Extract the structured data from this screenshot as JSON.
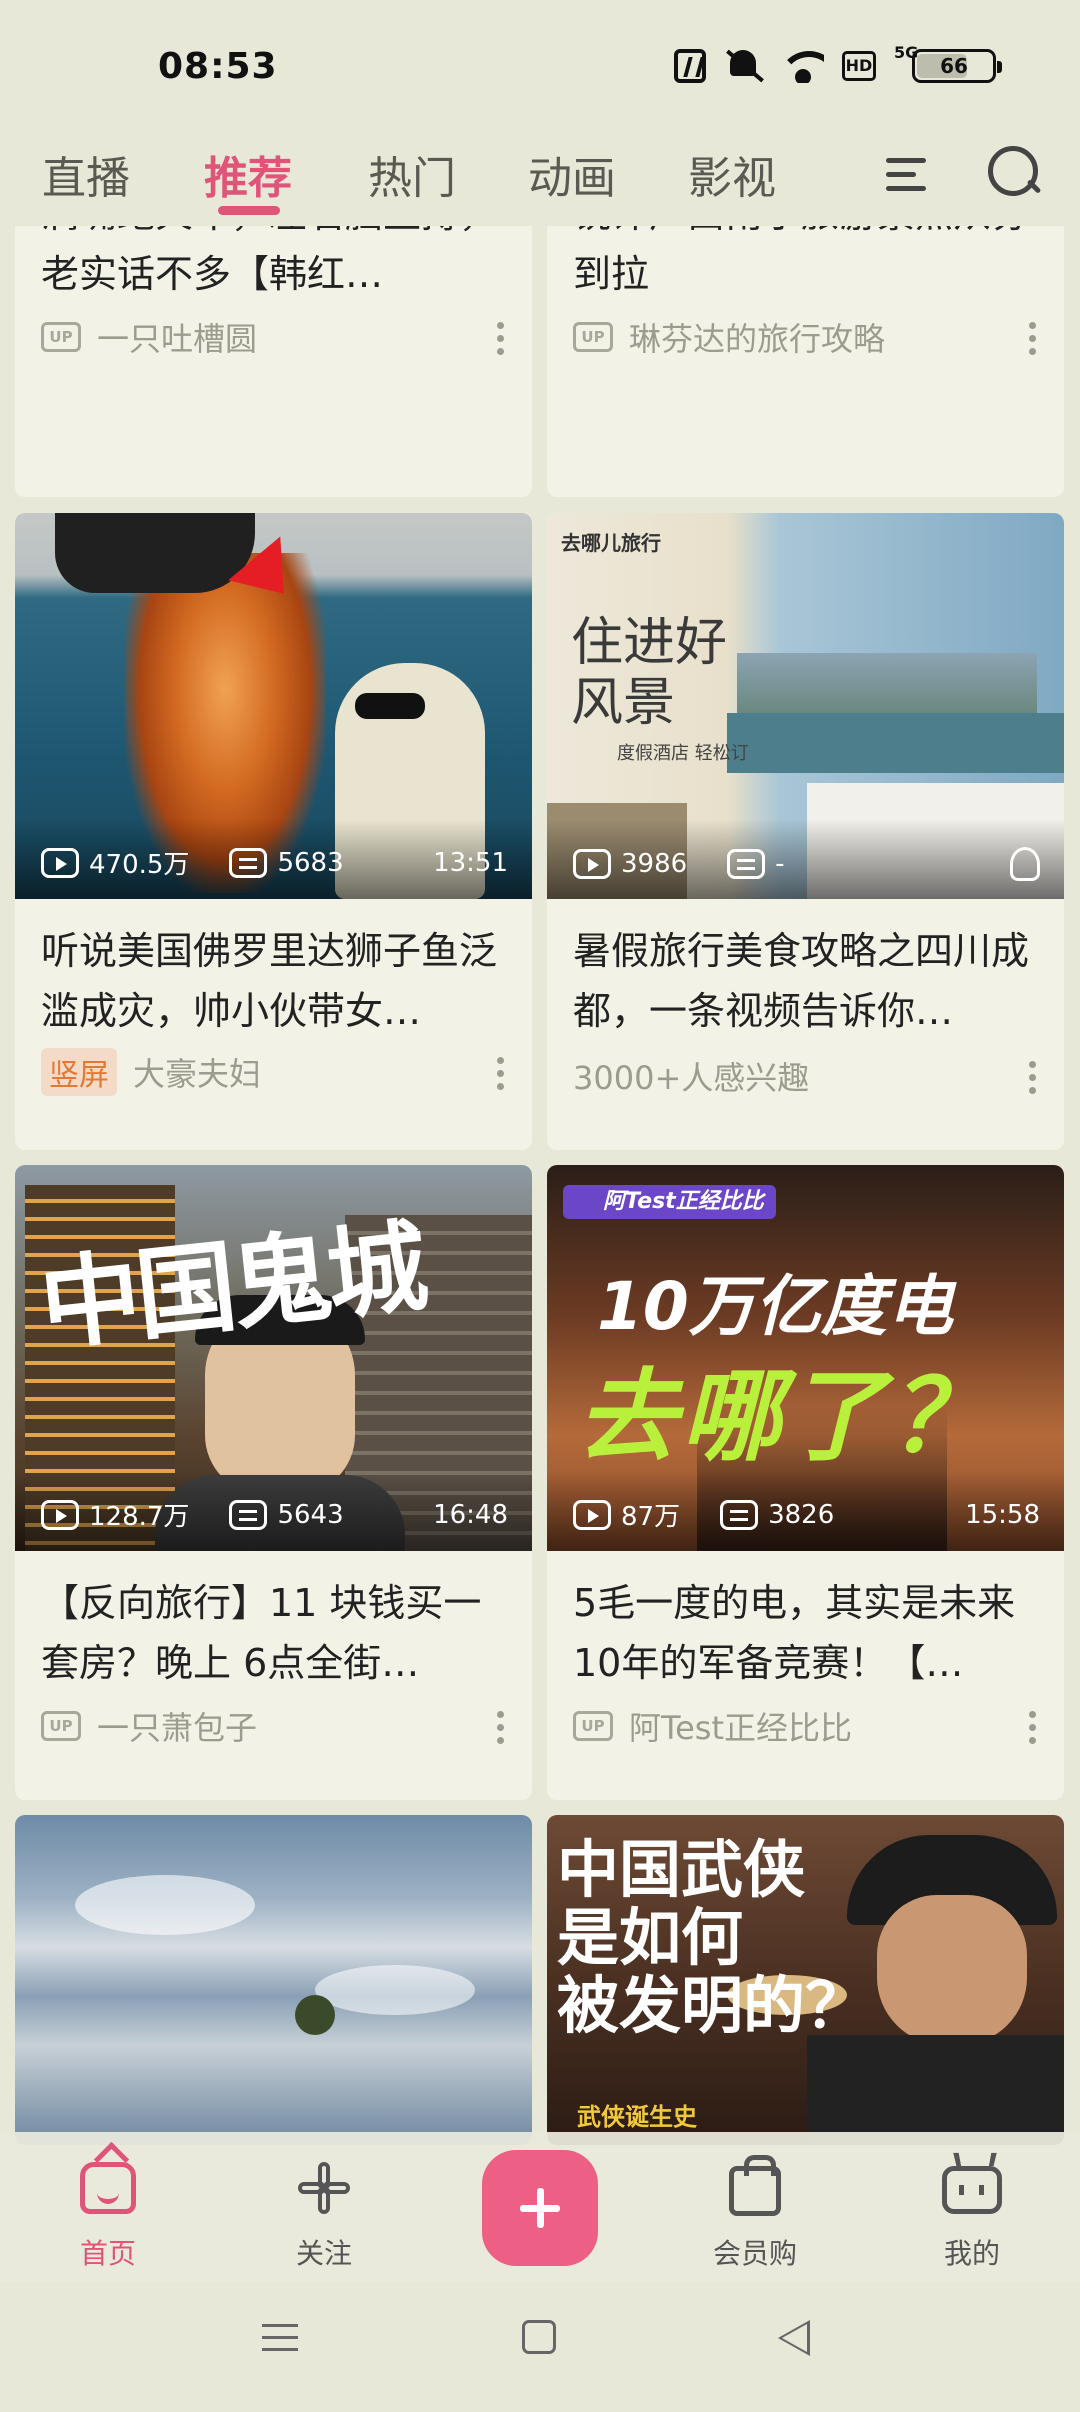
{
  "status_bar": {
    "time": "08:53",
    "battery": "66",
    "network": "5G",
    "hd": "HD"
  },
  "tabs": [
    {
      "label": "直播",
      "active": false
    },
    {
      "label": "推荐",
      "active": true
    },
    {
      "label": "热门",
      "active": false
    },
    {
      "label": "动画",
      "active": false
    },
    {
      "label": "影视",
      "active": false
    }
  ],
  "cards": [
    {
      "title": "满嘴跑火车，左右脑互搏，老实话不多【韩红…",
      "meta": "一只吐槽圆",
      "badge": "UP"
    },
    {
      "title": "锐评广西南宁旅游景点从夯到拉",
      "meta": "琳芬达的旅行攻略",
      "badge": "UP"
    },
    {
      "title": "听说美国佛罗里达狮子鱼泛滥成灾，帅小伙带女…",
      "meta": "大豪夫妇",
      "badge": "竖屏",
      "views": "470.5万",
      "danmaku": "5683",
      "duration": "13:51"
    },
    {
      "title": "暑假旅行美食攻略之四川成都，一条视频告诉你…",
      "meta": "3000+人感兴趣",
      "views": "3986",
      "danmaku": "-",
      "ad_brand": "去哪儿旅行",
      "ad_headline": "住进好风景",
      "ad_sub": "度假酒店 轻松订"
    },
    {
      "title": "【反向旅行】11 块钱买一套房？晚上 6点全街…",
      "meta": "一只萧包子",
      "badge": "UP",
      "views": "128.7万",
      "danmaku": "5643",
      "duration": "16:48",
      "cover_text": "中国鬼城"
    },
    {
      "title": "5毛一度的电，其实是未来10年的军备竞赛！【…",
      "meta": "阿Test正经比比",
      "badge": "UP",
      "views": "87万",
      "danmaku": "3826",
      "duration": "15:58",
      "cover_tag": "阿Test正经比比",
      "cover_line1": "10万亿度电",
      "cover_line2": "去哪了？"
    },
    {
      "title": "",
      "meta": ""
    },
    {
      "title": "",
      "meta": "",
      "cover_line1": "中国武侠",
      "cover_line2": "是如何",
      "cover_line3": "被发明的？",
      "cover_tag": "武侠诞生史"
    }
  ],
  "bottom_nav": [
    {
      "label": "首页",
      "icon": "home-icon",
      "active": true
    },
    {
      "label": "关注",
      "icon": "pinwheel-icon",
      "active": false
    },
    {
      "label": "",
      "icon": "plus-icon",
      "active": false
    },
    {
      "label": "会员购",
      "icon": "shopping-bag-icon",
      "active": false
    },
    {
      "label": "我的",
      "icon": "tv-icon",
      "active": false
    }
  ],
  "colors": {
    "accent": "#e0547a",
    "background": "#e8e8d9",
    "card": "#f2f2e6"
  }
}
